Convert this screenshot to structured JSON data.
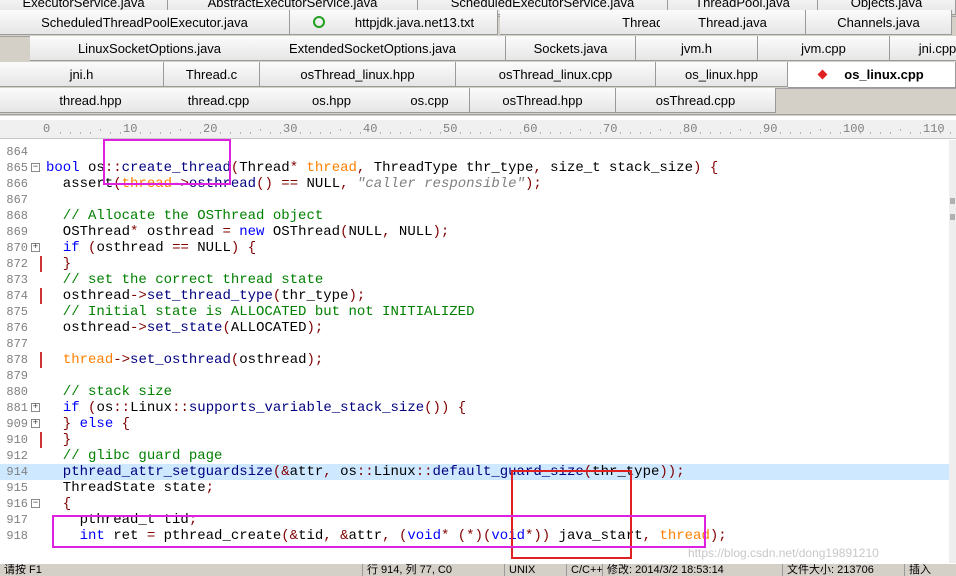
{
  "tab_rows": [
    [
      {
        "label": "ExecutorService.java"
      },
      {
        "label": "AbstractExecutorService.java"
      },
      {
        "label": "ScheduledExecutorService.java"
      },
      {
        "label": "ThreadPool.java"
      },
      {
        "label": "Objects.java"
      }
    ],
    [
      {
        "label": "ScheduledThreadPoolExecutor.java"
      },
      {
        "label": "httpjdk.java.net13.txt",
        "icon": "ring-icon"
      },
      {
        "label": "Thread.java"
      },
      {
        "label": "Thread.java"
      },
      {
        "label": "Channels.java"
      }
    ],
    [
      {
        "label": "LinuxSocketOptions.java"
      },
      {
        "label": "ExtendedSocketOptions.java"
      },
      {
        "label": "Sockets.java"
      },
      {
        "label": "jvm.h"
      },
      {
        "label": "jvm.cpp"
      },
      {
        "label": "jni.cpp"
      }
    ],
    [
      {
        "label": "jni.h"
      },
      {
        "label": "Thread.c"
      },
      {
        "label": "osThread_linux.hpp"
      },
      {
        "label": "osThread_linux.cpp"
      },
      {
        "label": "os_linux.hpp"
      },
      {
        "label": "os_linux.cpp",
        "icon": "diamond-icon",
        "active": true
      }
    ],
    [
      {
        "label": "thread.hpp"
      },
      {
        "label": "thread.cpp"
      },
      {
        "label": "os.hpp"
      },
      {
        "label": "os.cpp"
      },
      {
        "label": "osThread.hpp"
      },
      {
        "label": "osThread.cpp"
      }
    ]
  ],
  "ruler_labels": [
    "0",
    "10",
    "20",
    "30",
    "40",
    "50",
    "60",
    "70",
    "80",
    "90",
    "100",
    "110"
  ],
  "code_lines": [
    {
      "n": "864",
      "tokens": []
    },
    {
      "n": "865",
      "gutter": "fold",
      "tokens": [
        [
          "kw",
          "bool"
        ],
        [
          "p",
          " os"
        ],
        [
          "op",
          "::"
        ],
        [
          "fn",
          "create_thread"
        ],
        [
          "op",
          "("
        ],
        [
          "p",
          "Thread"
        ],
        [
          "op",
          "*"
        ],
        [
          "p",
          " "
        ],
        [
          "var",
          "thread"
        ],
        [
          "op",
          ","
        ],
        [
          "p",
          " ThreadType thr_type"
        ],
        [
          "op",
          ","
        ],
        [
          "p",
          " size_t stack_size"
        ],
        [
          "op",
          ")"
        ],
        [
          "p",
          " "
        ],
        [
          "op",
          "{"
        ]
      ]
    },
    {
      "n": "866",
      "tokens": [
        [
          "p",
          "  assert"
        ],
        [
          "op",
          "("
        ],
        [
          "var",
          "thread"
        ],
        [
          "op",
          "->"
        ],
        [
          "fn",
          "osthread"
        ],
        [
          "op",
          "()"
        ],
        [
          "p",
          " "
        ],
        [
          "op",
          "=="
        ],
        [
          "p",
          " NULL"
        ],
        [
          "op",
          ","
        ],
        [
          "p",
          " "
        ],
        [
          "str",
          "\"caller responsible\""
        ],
        [
          "op",
          ");"
        ]
      ]
    },
    {
      "n": "867",
      "tokens": []
    },
    {
      "n": "868",
      "tokens": [
        [
          "cm",
          "  // Allocate the OSThread object"
        ]
      ]
    },
    {
      "n": "869",
      "tokens": [
        [
          "p",
          "  OSThread"
        ],
        [
          "op",
          "*"
        ],
        [
          "p",
          " osthread "
        ],
        [
          "op",
          "="
        ],
        [
          "p",
          " "
        ],
        [
          "kw",
          "new"
        ],
        [
          "p",
          " OSThread"
        ],
        [
          "op",
          "("
        ],
        [
          "p",
          "NULL"
        ],
        [
          "op",
          ","
        ],
        [
          "p",
          " NULL"
        ],
        [
          "op",
          ");"
        ]
      ]
    },
    {
      "n": "870",
      "gutter": "fold",
      "tokens": [
        [
          "p",
          "  "
        ],
        [
          "kw",
          "if"
        ],
        [
          "p",
          " "
        ],
        [
          "op",
          "("
        ],
        [
          "p",
          "osthread "
        ],
        [
          "op",
          "=="
        ],
        [
          "p",
          " NULL"
        ],
        [
          "op",
          ")"
        ],
        [
          "p",
          " "
        ],
        [
          "op",
          "{"
        ]
      ]
    },
    {
      "n": "872",
      "gutter": "bar",
      "tokens": [
        [
          "op",
          "  }"
        ]
      ]
    },
    {
      "n": "873",
      "tokens": [
        [
          "cm",
          "  // set the correct thread state"
        ]
      ]
    },
    {
      "n": "874",
      "gutter": "bar",
      "tokens": [
        [
          "p",
          "  osthread"
        ],
        [
          "op",
          "->"
        ],
        [
          "fn",
          "set_thread_type"
        ],
        [
          "op",
          "("
        ],
        [
          "p",
          "thr_type"
        ],
        [
          "op",
          ");"
        ]
      ]
    },
    {
      "n": "875",
      "tokens": [
        [
          "cm",
          "  // Initial state is ALLOCATED but not INITIALIZED"
        ]
      ]
    },
    {
      "n": "876",
      "tokens": [
        [
          "p",
          "  osthread"
        ],
        [
          "op",
          "->"
        ],
        [
          "fn",
          "set_state"
        ],
        [
          "op",
          "("
        ],
        [
          "p",
          "ALLOCATED"
        ],
        [
          "op",
          ");"
        ]
      ]
    },
    {
      "n": "877",
      "tokens": []
    },
    {
      "n": "878",
      "gutter": "bar",
      "tokens": [
        [
          "p",
          "  "
        ],
        [
          "var",
          "thread"
        ],
        [
          "op",
          "->"
        ],
        [
          "fn",
          "set_osthread"
        ],
        [
          "op",
          "("
        ],
        [
          "p",
          "osthread"
        ],
        [
          "op",
          ");"
        ]
      ]
    },
    {
      "n": "879",
      "tokens": []
    },
    {
      "n": "880",
      "tokens": [
        [
          "cm",
          "  // stack size"
        ]
      ]
    },
    {
      "n": "881",
      "gutter": "fold",
      "tokens": [
        [
          "p",
          "  "
        ],
        [
          "kw",
          "if"
        ],
        [
          "p",
          " "
        ],
        [
          "op",
          "("
        ],
        [
          "p",
          "os"
        ],
        [
          "op",
          "::"
        ],
        [
          "p",
          "Linux"
        ],
        [
          "op",
          "::"
        ],
        [
          "fn",
          "supports_variable_stack_size"
        ],
        [
          "op",
          "())"
        ],
        [
          "p",
          " "
        ],
        [
          "op",
          "{"
        ]
      ]
    },
    {
      "n": "909",
      "gutter": "fold",
      "tokens": [
        [
          "op",
          "  }"
        ],
        [
          "p",
          " "
        ],
        [
          "kw",
          "else"
        ],
        [
          "p",
          " "
        ],
        [
          "op",
          "{"
        ]
      ]
    },
    {
      "n": "910",
      "gutter": "bar",
      "tokens": [
        [
          "op",
          "  }"
        ]
      ]
    },
    {
      "n": "912",
      "tokens": [
        [
          "cm",
          "  // glibc guard page"
        ]
      ]
    },
    {
      "n": "914",
      "hl": true,
      "tokens": [
        [
          "fn",
          "  pthread_attr_setguardsize"
        ],
        [
          "op",
          "(&"
        ],
        [
          "p",
          "attr"
        ],
        [
          "op",
          ","
        ],
        [
          "p",
          " os"
        ],
        [
          "op",
          "::"
        ],
        [
          "p",
          "Linux"
        ],
        [
          "op",
          "::"
        ],
        [
          "fn",
          "default_guard_size"
        ],
        [
          "op",
          "("
        ],
        [
          "p",
          "thr_type"
        ],
        [
          "op",
          "));"
        ]
      ]
    },
    {
      "n": "915",
      "tokens": [
        [
          "p",
          "  ThreadState state"
        ],
        [
          "op",
          ";"
        ]
      ]
    },
    {
      "n": "916",
      "gutter": "fold",
      "tokens": [
        [
          "op",
          "  {"
        ]
      ]
    },
    {
      "n": "917",
      "tokens": [
        [
          "p",
          "    pthread_t tid"
        ],
        [
          "op",
          ";"
        ]
      ]
    },
    {
      "n": "918",
      "tokens": [
        [
          "p",
          "    "
        ],
        [
          "kw",
          "int"
        ],
        [
          "p",
          " ret "
        ],
        [
          "op",
          "="
        ],
        [
          "p",
          " pthread_create"
        ],
        [
          "op",
          "(&"
        ],
        [
          "p",
          "tid"
        ],
        [
          "op",
          ","
        ],
        [
          "p",
          " "
        ],
        [
          "op",
          "&"
        ],
        [
          "p",
          "attr"
        ],
        [
          "op",
          ","
        ],
        [
          "p",
          " "
        ],
        [
          "op",
          "("
        ],
        [
          "kw",
          "void"
        ],
        [
          "op",
          "*"
        ],
        [
          "p",
          " "
        ],
        [
          "op",
          "(*)("
        ],
        [
          "kw",
          "void"
        ],
        [
          "op",
          "*))"
        ],
        [
          "p",
          " java_start"
        ],
        [
          "op",
          ","
        ],
        [
          "p",
          " "
        ],
        [
          "var",
          "thread"
        ],
        [
          "op",
          ");"
        ]
      ]
    }
  ],
  "status": {
    "s1": "请按 F1",
    "s2": "行 914, 列 77, C0",
    "s3": "UNIX",
    "s4": "C/C++",
    "s5": "修改: 2014/3/2 18:53:14",
    "s6": "文件大小: 213706",
    "s7": "插入"
  },
  "watermark": "https://blog.csdn.net/dong19891210",
  "colors": {
    "keyword": "#0000ff",
    "comment": "#008000",
    "operator": "#800000",
    "variable": "#ff8000",
    "highlight_line": "#cde8ff",
    "annotation_magenta": "#e020e0",
    "annotation_red": "#e02020"
  }
}
